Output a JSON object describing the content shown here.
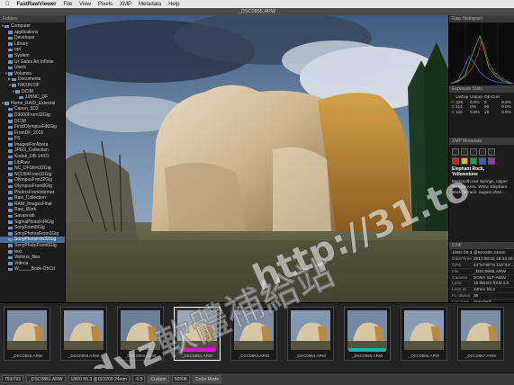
{
  "menubar": {
    "apple": "",
    "app_name": "FastRawViewer",
    "items": [
      "File",
      "View",
      "Pixels",
      "XMP",
      "Metadata",
      "Help"
    ]
  },
  "window_title": "_DSC0865.ARW",
  "folders_panel": {
    "title": "Folders",
    "tree": [
      {
        "label": "Computer",
        "depth": 0,
        "tri": "▼"
      },
      {
        "label": "applications",
        "depth": 1
      },
      {
        "label": "Developer",
        "depth": 1
      },
      {
        "label": "Library",
        "depth": 1
      },
      {
        "label": "opt",
        "depth": 1
      },
      {
        "label": "System",
        "depth": 1
      },
      {
        "label": "Ur Gates Art Infinite",
        "depth": 1
      },
      {
        "label": "Users",
        "depth": 1
      },
      {
        "label": "Volumes",
        "depth": 1,
        "tri": "▼"
      },
      {
        "label": "Documents",
        "depth": 2,
        "tri": "▶"
      },
      {
        "label": "NIKON DF",
        "depth": 2,
        "tri": "▼"
      },
      {
        "label": "DCIM",
        "depth": 3,
        "tri": "▼"
      },
      {
        "label": "105NC_DF",
        "depth": 4
      },
      {
        "label": "Home_RAID_External",
        "depth": 0,
        "tri": "▼"
      },
      {
        "label": "Canon_5D2",
        "depth": 1
      },
      {
        "label": "D3000From32Gig",
        "depth": 1
      },
      {
        "label": "DCIM",
        "depth": 1
      },
      {
        "label": "FinalOlympusFd6Gig",
        "depth": 1
      },
      {
        "label": "FromDF_2015",
        "depth": 1
      },
      {
        "label": "FS",
        "depth": 1
      },
      {
        "label": "ImagesForAtreta",
        "depth": 1
      },
      {
        "label": "JPEG_Collection",
        "depth": 1
      },
      {
        "label": "Kodak_DB-14XO",
        "depth": 1
      },
      {
        "label": "LibRaw",
        "depth": 1
      },
      {
        "label": "NC_DFSfrm32Gig",
        "depth": 1
      },
      {
        "label": "NCD84From32Gig",
        "depth": 1
      },
      {
        "label": "OlympusFrm32Gig",
        "depth": 1
      },
      {
        "label": "OlympusFrom8Gig",
        "depth": 1
      },
      {
        "label": "PhotosFromInternet",
        "depth": 1
      },
      {
        "label": "Raw_Collection",
        "depth": 1
      },
      {
        "label": "RAW_ImagesFinal",
        "depth": 1
      },
      {
        "label": "Raw_Work",
        "depth": 1
      },
      {
        "label": "Savannah",
        "depth": 1
      },
      {
        "label": "SigmaPhotoFd4Gig",
        "depth": 1
      },
      {
        "label": "SonyFrom8Gig",
        "depth": 1
      },
      {
        "label": "SonyPhotosFrom2Gig",
        "depth": 1
      },
      {
        "label": "SonyPhotsFrm32Gig",
        "depth": 1,
        "selected": true
      },
      {
        "label": "SonyPhotoFrom6Gig",
        "depth": 1
      },
      {
        "label": "text",
        "depth": 1
      },
      {
        "label": "Various_files",
        "depth": 1
      },
      {
        "label": "Videos",
        "depth": 1
      },
      {
        "label": "W_____Book-OnCd",
        "depth": 1
      }
    ]
  },
  "raw_histogram": {
    "title": "Raw Histogram"
  },
  "exposure_stats": {
    "title": "Exposure Stats",
    "headers": [
      "",
      "UnExp",
      "UnExp",
      "OE-Corr"
    ],
    "rows": [
      [
        "R",
        "22K",
        "0.0%",
        "0",
        "0.0%"
      ],
      [
        "G",
        "114",
        "0%",
        "99",
        "0.0%"
      ],
      [
        "B",
        "11K",
        "0.5%",
        "19",
        "0.0%"
      ]
    ]
  },
  "xmp_panel": {
    "title": "XMP Metadata",
    "swatch_colors": [
      "#d02020",
      "#e0c020",
      "#20a040",
      "#2060d0",
      "#a030c0"
    ],
    "image_title": "Elephant Rock, Yellowstone",
    "caption": "Mammoth Hot Springs, Upper Terrace Area, White Elephant Back Terrace, august 2011"
  },
  "exif_panel": {
    "title": "EXIF",
    "rows": [
      {
        "k": "",
        "v": "1/80s f/6.3 @ISO200 24mm"
      },
      {
        "k": "Date/Time",
        "v": "2011:08:22 18:44:48"
      },
      {
        "k": "GPS",
        "v": "44°57'55\"N 110°43'..."
      },
      {
        "k": "File",
        "v": "_DSC0865.ARW"
      },
      {
        "k": "Camera",
        "v": "SONY SLT-A55V"
      },
      {
        "k": "Lens",
        "v": "16-80mm f/3.5-4.5"
      },
      {
        "k": "Lens at",
        "v": "24mm f/6.3"
      },
      {
        "k": "FL-35mm",
        "v": "36"
      },
      {
        "k": "Cnt.Type",
        "v": "Standard"
      },
      {
        "k": "WB",
        "v": "Manual"
      }
    ]
  },
  "filmstrip": [
    {
      "label": "_DSC0858.ARW",
      "selected": false,
      "rating_color": ""
    },
    {
      "label": "_DSC0859.ARW",
      "selected": false,
      "rating_color": ""
    },
    {
      "label": "_DSC0860.ARW",
      "selected": false,
      "rating_color": ""
    },
    {
      "label": "_DSC0861.ARW",
      "selected": true,
      "rating_color": "#d020c0"
    },
    {
      "label": "_DSC0863.ARW",
      "selected": false,
      "rating_color": ""
    },
    {
      "label": "_DSC0864.ARW",
      "selected": false,
      "rating_color": ""
    },
    {
      "label": "_DSC0865.ARW",
      "selected": false,
      "rating_color": "#20b0b0"
    },
    {
      "label": "_DSC0866.ARW",
      "selected": false,
      "rating_color": ""
    },
    {
      "label": "_DSC0867.ARW",
      "selected": false,
      "rating_color": ""
    }
  ],
  "status": {
    "counter": "793/793",
    "file": "_DSC0861.ARW",
    "exposure": "1/800 f/6.3 @ISO200 24mm",
    "ev": "-0.5",
    "wb_mode": "Custom",
    "temp": "5050K",
    "color_mode": "Color Mode"
  },
  "watermark": {
    "chinese": "dyz軟體補給站",
    "url": "http://31.to"
  }
}
